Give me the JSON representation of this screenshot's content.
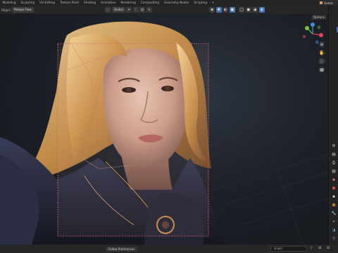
{
  "topbar": {
    "tabs": [
      {
        "label": "Modeling",
        "active": false
      },
      {
        "label": "Sculpting",
        "active": false
      },
      {
        "label": "UV Editing",
        "active": false
      },
      {
        "label": "Texture Paint",
        "active": false
      },
      {
        "label": "Shading",
        "active": false
      },
      {
        "label": "Animation",
        "active": false
      },
      {
        "label": "Rendering",
        "active": false
      },
      {
        "label": "Compositing",
        "active": false
      },
      {
        "label": "Geometry Nodes",
        "active": false
      },
      {
        "label": "Scripting",
        "active": false
      }
    ],
    "add_tab_label": "+",
    "scene_label": "Scene"
  },
  "header": {
    "mode_label": "Object",
    "overlay_label": "Retopo Flow",
    "orientation_label": "Global",
    "options_label": "Options"
  },
  "viewport": {
    "gizmo": {
      "x_label": "X",
      "y_label": "Y",
      "z_label": "Z",
      "accent_x": "#e0445a",
      "accent_y": "#7fbf3f",
      "accent_z": "#3f8fe0"
    }
  },
  "status": {
    "left_button_label": "Follow Preferences",
    "search_placeholder": "shield"
  },
  "colors": {
    "accent": "#4772b3",
    "camera_frame": "#d46a6a"
  }
}
